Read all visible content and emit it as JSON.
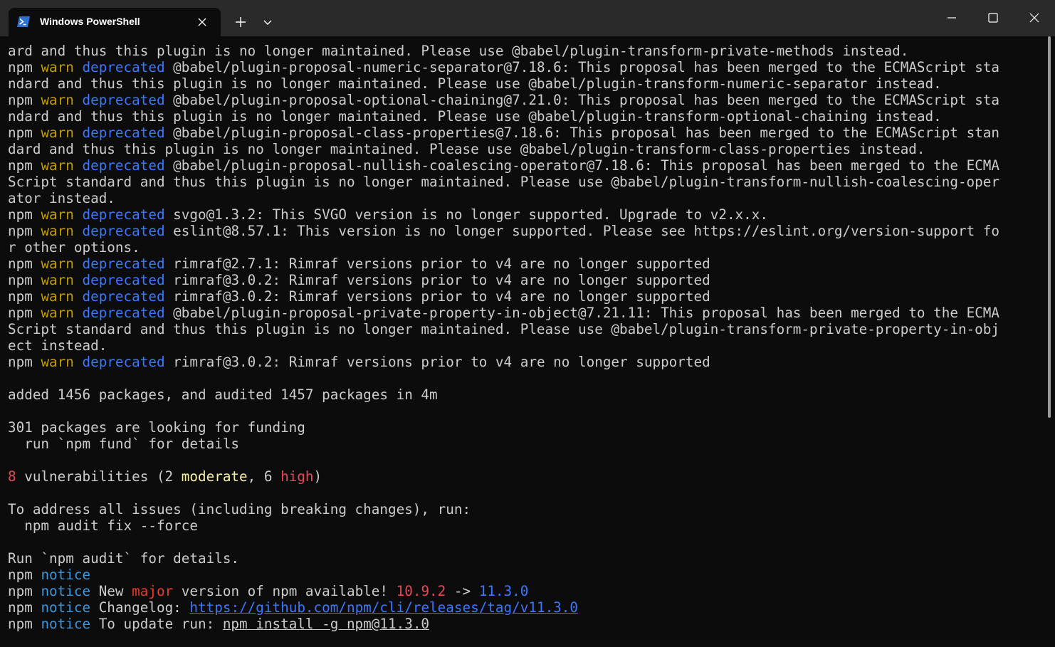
{
  "window": {
    "tab_title": "Windows PowerShell",
    "new_tab_label": "+",
    "icons": {
      "tab": "powershell-icon",
      "close_tab": "close-icon",
      "new_tab": "plus-icon",
      "dropdown": "chevron-down-icon",
      "minimize": "minimize-icon",
      "maximize": "maximize-icon",
      "close_window": "close-icon"
    }
  },
  "colors": {
    "background": "#0c0c0c",
    "titlebar": "#2a2a2a",
    "text": "#cccccc",
    "warn": "#c19c00",
    "deprecated": "#3b78ff",
    "notice": "#3a96dd",
    "vuln_count": "#e74856",
    "moderate": "#f9f1a5",
    "high": "#e74856",
    "major": "#e83a2b",
    "link": "#3b78ff"
  },
  "terminal": {
    "lines": [
      {
        "parts": [
          {
            "t": "ard and thus this plugin is no longer maintained. Please use @babel/plugin-transform-private-methods instead."
          }
        ]
      },
      {
        "parts": [
          {
            "t": "npm "
          },
          {
            "t": "warn",
            "c": "warn"
          },
          {
            "t": " "
          },
          {
            "t": "deprecated",
            "c": "dep"
          },
          {
            "t": " @babel/plugin-proposal-numeric-separator@7.18.6: This proposal has been merged to the ECMAScript sta"
          }
        ]
      },
      {
        "parts": [
          {
            "t": "ndard and thus this plugin is no longer maintained. Please use @babel/plugin-transform-numeric-separator instead."
          }
        ]
      },
      {
        "parts": [
          {
            "t": "npm "
          },
          {
            "t": "warn",
            "c": "warn"
          },
          {
            "t": " "
          },
          {
            "t": "deprecated",
            "c": "dep"
          },
          {
            "t": " @babel/plugin-proposal-optional-chaining@7.21.0: This proposal has been merged to the ECMAScript sta"
          }
        ]
      },
      {
        "parts": [
          {
            "t": "ndard and thus this plugin is no longer maintained. Please use @babel/plugin-transform-optional-chaining instead."
          }
        ]
      },
      {
        "parts": [
          {
            "t": "npm "
          },
          {
            "t": "warn",
            "c": "warn"
          },
          {
            "t": " "
          },
          {
            "t": "deprecated",
            "c": "dep"
          },
          {
            "t": " @babel/plugin-proposal-class-properties@7.18.6: This proposal has been merged to the ECMAScript stan"
          }
        ]
      },
      {
        "parts": [
          {
            "t": "dard and thus this plugin is no longer maintained. Please use @babel/plugin-transform-class-properties instead."
          }
        ]
      },
      {
        "parts": [
          {
            "t": "npm "
          },
          {
            "t": "warn",
            "c": "warn"
          },
          {
            "t": " "
          },
          {
            "t": "deprecated",
            "c": "dep"
          },
          {
            "t": " @babel/plugin-proposal-nullish-coalescing-operator@7.18.6: This proposal has been merged to the ECMA"
          }
        ]
      },
      {
        "parts": [
          {
            "t": "Script standard and thus this plugin is no longer maintained. Please use @babel/plugin-transform-nullish-coalescing-oper"
          }
        ]
      },
      {
        "parts": [
          {
            "t": "ator instead."
          }
        ]
      },
      {
        "parts": [
          {
            "t": "npm "
          },
          {
            "t": "warn",
            "c": "warn"
          },
          {
            "t": " "
          },
          {
            "t": "deprecated",
            "c": "dep"
          },
          {
            "t": " svgo@1.3.2: This SVGO version is no longer supported. Upgrade to v2.x.x."
          }
        ]
      },
      {
        "parts": [
          {
            "t": "npm "
          },
          {
            "t": "warn",
            "c": "warn"
          },
          {
            "t": " "
          },
          {
            "t": "deprecated",
            "c": "dep"
          },
          {
            "t": " eslint@8.57.1: This version is no longer supported. Please see https://eslint.org/version-support fo"
          }
        ]
      },
      {
        "parts": [
          {
            "t": "r other options."
          }
        ]
      },
      {
        "parts": [
          {
            "t": "npm "
          },
          {
            "t": "warn",
            "c": "warn"
          },
          {
            "t": " "
          },
          {
            "t": "deprecated",
            "c": "dep"
          },
          {
            "t": " rimraf@2.7.1: Rimraf versions prior to v4 are no longer supported"
          }
        ]
      },
      {
        "parts": [
          {
            "t": "npm "
          },
          {
            "t": "warn",
            "c": "warn"
          },
          {
            "t": " "
          },
          {
            "t": "deprecated",
            "c": "dep"
          },
          {
            "t": " rimraf@3.0.2: Rimraf versions prior to v4 are no longer supported"
          }
        ]
      },
      {
        "parts": [
          {
            "t": "npm "
          },
          {
            "t": "warn",
            "c": "warn"
          },
          {
            "t": " "
          },
          {
            "t": "deprecated",
            "c": "dep"
          },
          {
            "t": " rimraf@3.0.2: Rimraf versions prior to v4 are no longer supported"
          }
        ]
      },
      {
        "parts": [
          {
            "t": "npm "
          },
          {
            "t": "warn",
            "c": "warn"
          },
          {
            "t": " "
          },
          {
            "t": "deprecated",
            "c": "dep"
          },
          {
            "t": " @babel/plugin-proposal-private-property-in-object@7.21.11: This proposal has been merged to the ECMA"
          }
        ]
      },
      {
        "parts": [
          {
            "t": "Script standard and thus this plugin is no longer maintained. Please use @babel/plugin-transform-private-property-in-obj"
          }
        ]
      },
      {
        "parts": [
          {
            "t": "ect instead."
          }
        ]
      },
      {
        "parts": [
          {
            "t": "npm "
          },
          {
            "t": "warn",
            "c": "warn"
          },
          {
            "t": " "
          },
          {
            "t": "deprecated",
            "c": "dep"
          },
          {
            "t": " rimraf@3.0.2: Rimraf versions prior to v4 are no longer supported"
          }
        ]
      },
      {
        "parts": [
          {
            "t": ""
          }
        ]
      },
      {
        "parts": [
          {
            "t": "added 1456 packages, and audited 1457 packages in 4m"
          }
        ]
      },
      {
        "parts": [
          {
            "t": ""
          }
        ]
      },
      {
        "parts": [
          {
            "t": "301 packages are looking for funding"
          }
        ]
      },
      {
        "parts": [
          {
            "t": "  run `npm fund` for details"
          }
        ]
      },
      {
        "parts": [
          {
            "t": ""
          }
        ]
      },
      {
        "parts": [
          {
            "t": "8",
            "c": "red"
          },
          {
            "t": " vulnerabilities (2 "
          },
          {
            "t": "moderate",
            "c": "yellow"
          },
          {
            "t": ", 6 "
          },
          {
            "t": "high",
            "c": "red"
          },
          {
            "t": ")"
          }
        ]
      },
      {
        "parts": [
          {
            "t": ""
          }
        ]
      },
      {
        "parts": [
          {
            "t": "To address all issues (including breaking changes), run:"
          }
        ]
      },
      {
        "parts": [
          {
            "t": "  npm audit fix --force"
          }
        ]
      },
      {
        "parts": [
          {
            "t": ""
          }
        ]
      },
      {
        "parts": [
          {
            "t": "Run `npm audit` for details."
          }
        ]
      },
      {
        "parts": [
          {
            "t": "npm "
          },
          {
            "t": "notice",
            "c": "notice"
          }
        ]
      },
      {
        "parts": [
          {
            "t": "npm "
          },
          {
            "t": "notice",
            "c": "notice"
          },
          {
            "t": " New "
          },
          {
            "t": "major",
            "c": "major"
          },
          {
            "t": " version of npm available! "
          },
          {
            "t": "10.9.2",
            "c": "oldver"
          },
          {
            "t": " -> "
          },
          {
            "t": "11.3.0",
            "c": "newver"
          }
        ]
      },
      {
        "parts": [
          {
            "t": "npm "
          },
          {
            "t": "notice",
            "c": "notice"
          },
          {
            "t": " Changelog: "
          },
          {
            "t": "https://github.com/npm/cli/releases/tag/v11.3.0",
            "c": "link"
          }
        ]
      },
      {
        "parts": [
          {
            "t": "npm "
          },
          {
            "t": "notice",
            "c": "notice"
          },
          {
            "t": " To update run: "
          },
          {
            "t": "npm install -g npm@11.3.0",
            "c": "underline"
          }
        ]
      }
    ]
  }
}
